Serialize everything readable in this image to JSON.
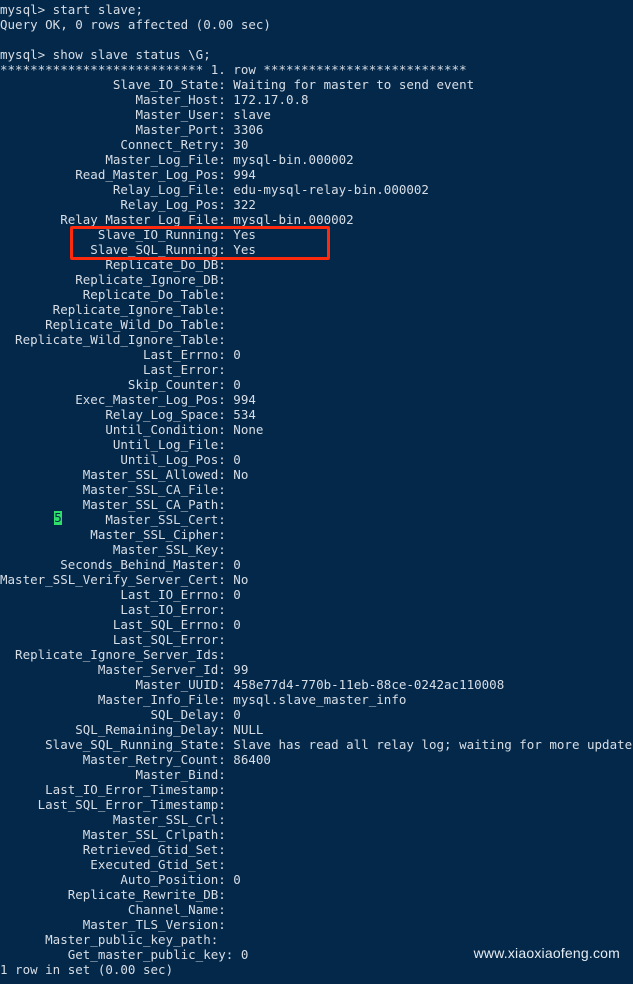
{
  "terminal": {
    "background_color": "#03284a",
    "text_color": "#d8dee6",
    "annotation_color": "#fe2a0d",
    "cursor_color": "#2ee06a",
    "cursor_char": "5",
    "watermark": "www.xiaoxiaofeng.com",
    "label_column_width": 26,
    "lines": [
      "mysql> start slave;",
      "Query OK, 0 rows affected (0.00 sec)",
      "",
      "mysql> show slave status \\G;",
      "*************************** 1. row ***************************",
      "               Slave_IO_State: Waiting for master to send event",
      "                  Master_Host: 172.17.0.8",
      "                  Master_User: slave",
      "                  Master_Port: 3306",
      "                Connect_Retry: 30",
      "              Master_Log_File: mysql-bin.000002",
      "          Read_Master_Log_Pos: 994",
      "               Relay_Log_File: edu-mysql-relay-bin.000002",
      "                Relay_Log_Pos: 322",
      "        Relay_Master_Log_File: mysql-bin.000002",
      "             Slave_IO_Running: Yes",
      "            Slave_SQL_Running: Yes",
      "              Replicate_Do_DB:",
      "          Replicate_Ignore_DB:",
      "           Replicate_Do_Table:",
      "       Replicate_Ignore_Table:",
      "      Replicate_Wild_Do_Table:",
      "  Replicate_Wild_Ignore_Table:",
      "                   Last_Errno: 0",
      "                   Last_Error:",
      "                 Skip_Counter: 0",
      "          Exec_Master_Log_Pos: 994",
      "              Relay_Log_Space: 534",
      "              Until_Condition: None",
      "               Until_Log_File:",
      "                Until_Log_Pos: 0",
      "           Master_SSL_Allowed: No",
      "           Master_SSL_CA_File:",
      "           Master_SSL_CA_Path:",
      "              Master_SSL_Cert:",
      "            Master_SSL_Cipher:",
      "               Master_SSL_Key:",
      "        Seconds_Behind_Master: 0",
      "Master_SSL_Verify_Server_Cert: No",
      "                Last_IO_Errno: 0",
      "                Last_IO_Error:",
      "               Last_SQL_Errno: 0",
      "               Last_SQL_Error:",
      "  Replicate_Ignore_Server_Ids:",
      "             Master_Server_Id: 99",
      "                  Master_UUID: 458e77d4-770b-11eb-88ce-0242ac110008",
      "             Master_Info_File: mysql.slave_master_info",
      "                    SQL_Delay: 0",
      "          SQL_Remaining_Delay: NULL",
      "      Slave_SQL_Running_State: Slave has read all relay log; waiting for more updates",
      "           Master_Retry_Count: 86400",
      "                  Master_Bind:",
      "      Last_IO_Error_Timestamp:",
      "     Last_SQL_Error_Timestamp:",
      "               Master_SSL_Crl:",
      "           Master_SSL_Crlpath:",
      "           Retrieved_Gtid_Set:",
      "            Executed_Gtid_Set:",
      "                Auto_Position: 0",
      "         Replicate_Rewrite_DB:",
      "                 Channel_Name:",
      "           Master_TLS_Version:",
      "      Master_public_key_path:",
      "         Get_master_public_key: 0",
      "1 row in set (0.00 sec)"
    ],
    "status_fields": {
      "Slave_IO_State": "Waiting for master to send event",
      "Master_Host": "172.17.0.8",
      "Master_User": "slave",
      "Master_Port": "3306",
      "Connect_Retry": "30",
      "Master_Log_File": "mysql-bin.000002",
      "Read_Master_Log_Pos": "994",
      "Relay_Log_File": "edu-mysql-relay-bin.000002",
      "Relay_Log_Pos": "322",
      "Relay_Master_Log_File": "mysql-bin.000002",
      "Slave_IO_Running": "Yes",
      "Slave_SQL_Running": "Yes",
      "Replicate_Do_DB": "",
      "Replicate_Ignore_DB": "",
      "Replicate_Do_Table": "",
      "Replicate_Ignore_Table": "",
      "Replicate_Wild_Do_Table": "",
      "Replicate_Wild_Ignore_Table": "",
      "Last_Errno": "0",
      "Last_Error": "",
      "Skip_Counter": "0",
      "Exec_Master_Log_Pos": "994",
      "Relay_Log_Space": "534",
      "Until_Condition": "None",
      "Until_Log_File": "",
      "Until_Log_Pos": "0",
      "Master_SSL_Allowed": "No",
      "Master_SSL_CA_File": "",
      "Master_SSL_CA_Path": "",
      "Master_SSL_Cert": "",
      "Master_SSL_Cipher": "",
      "Master_SSL_Key": "",
      "Seconds_Behind_Master": "0",
      "Master_SSL_Verify_Server_Cert": "No",
      "Last_IO_Errno": "0",
      "Last_IO_Error": "",
      "Last_SQL_Errno": "0",
      "Last_SQL_Error": "",
      "Replicate_Ignore_Server_Ids": "",
      "Master_Server_Id": "99",
      "Master_UUID": "458e77d4-770b-11eb-88ce-0242ac110008",
      "Master_Info_File": "mysql.slave_master_info",
      "SQL_Delay": "0",
      "SQL_Remaining_Delay": "NULL",
      "Slave_SQL_Running_State": "Slave has read all relay log; waiting for more updates",
      "Master_Retry_Count": "86400",
      "Master_Bind": "",
      "Last_IO_Error_Timestamp": "",
      "Last_SQL_Error_Timestamp": "",
      "Master_SSL_Crl": "",
      "Master_SSL_Crlpath": "",
      "Retrieved_Gtid_Set": "",
      "Executed_Gtid_Set": "",
      "Auto_Position": "0",
      "Replicate_Rewrite_DB": "",
      "Channel_Name": "",
      "Master_TLS_Version": "",
      "Master_public_key_path": "",
      "Get_master_public_key": "0"
    },
    "commands": [
      "start slave;",
      "show slave status \\G;"
    ],
    "results": [
      "Query OK, 0 rows affected (0.00 sec)",
      "1 row in set (0.00 sec)"
    ],
    "row_header": "*************************** 1. row ***************************",
    "footer": "1 row in set (0.00 sec)"
  }
}
